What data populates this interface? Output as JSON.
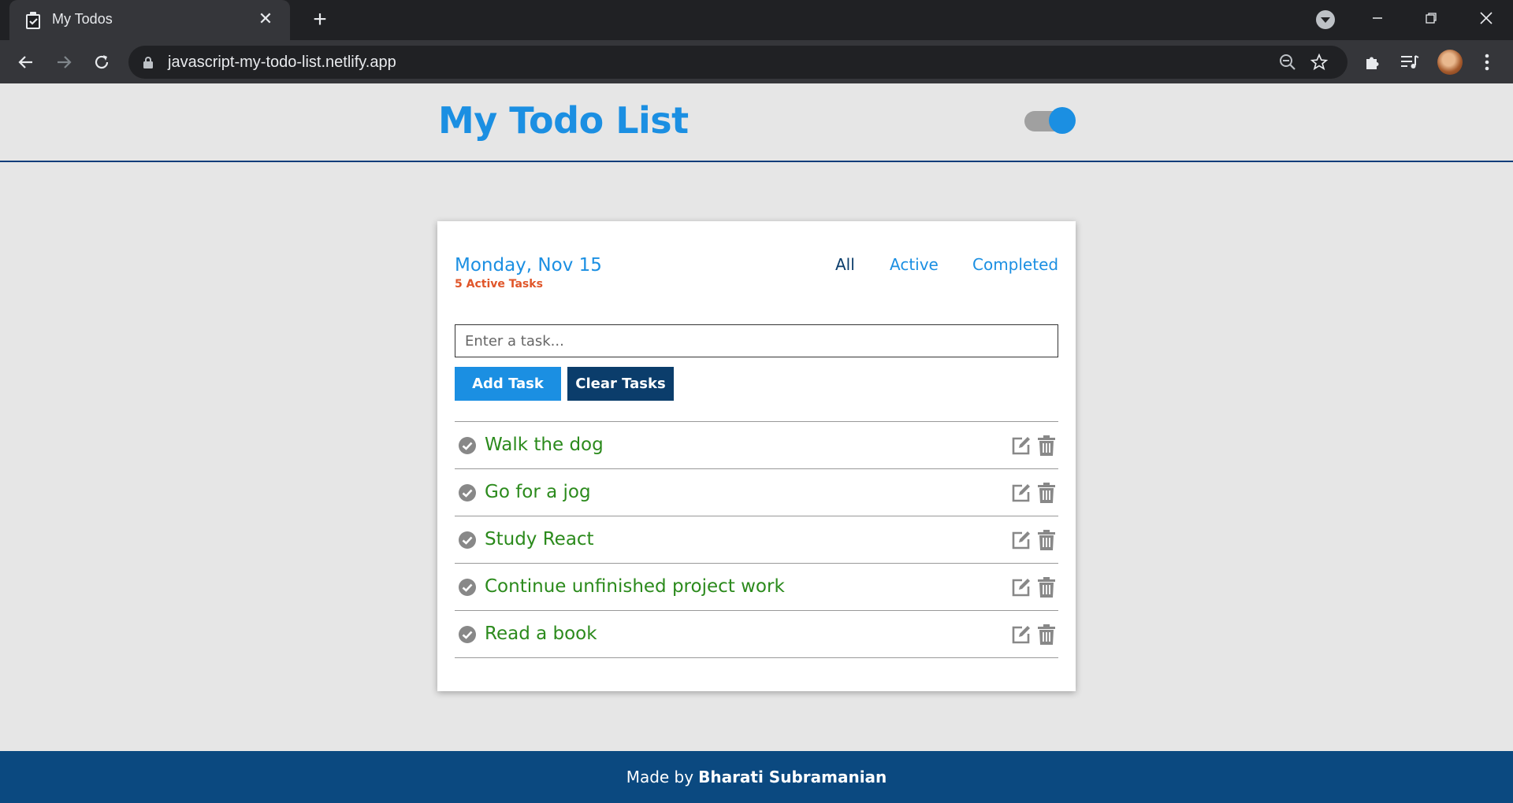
{
  "browser": {
    "tab_title": "My Todos",
    "url": "javascript-my-todo-list.netlify.app"
  },
  "app": {
    "title": "My Todo List",
    "theme_toggle_on": true
  },
  "card": {
    "date": "Monday, Nov 15",
    "active_count": "5 Active Tasks",
    "filters": [
      {
        "label": "All",
        "selected": true
      },
      {
        "label": "Active",
        "selected": false
      },
      {
        "label": "Completed",
        "selected": false
      }
    ],
    "input_placeholder": "Enter a task...",
    "add_button": "Add Task",
    "clear_button": "Clear Tasks",
    "tasks": [
      {
        "text": "Walk the dog"
      },
      {
        "text": "Go for a jog"
      },
      {
        "text": "Study React"
      },
      {
        "text": "Continue unfinished project work"
      },
      {
        "text": "Read a book"
      }
    ]
  },
  "footer": {
    "prefix": "Made by",
    "author": "Bharati Subramanian"
  },
  "colors": {
    "accent_blue": "#1b8fe2",
    "dark_navy": "#0b3d6b",
    "task_green": "#2b8a1c",
    "active_count_orange": "#e0562a",
    "footer_bg": "#0b4980"
  }
}
